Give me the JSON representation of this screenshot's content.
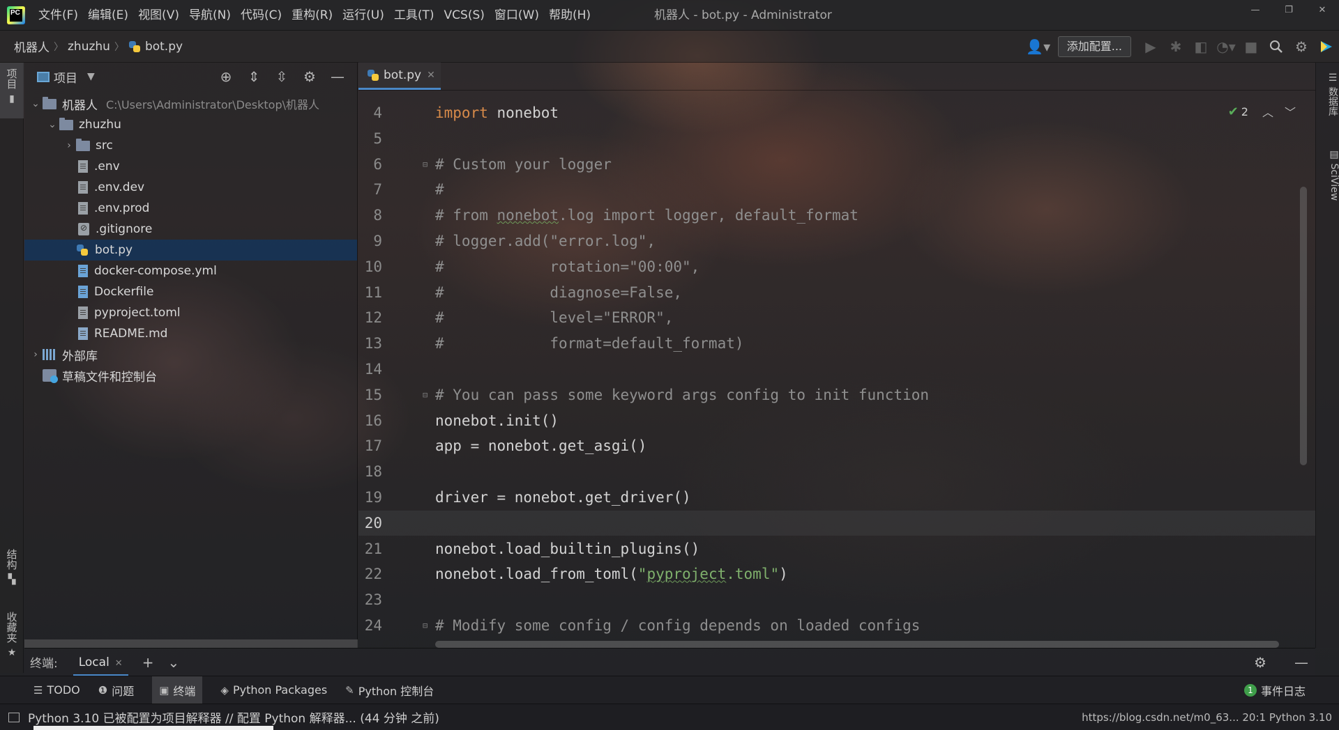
{
  "titlebar": {
    "menu": [
      "文件(F)",
      "编辑(E)",
      "视图(V)",
      "导航(N)",
      "代码(C)",
      "重构(R)",
      "运行(U)",
      "工具(T)",
      "VCS(S)",
      "窗口(W)",
      "帮助(H)"
    ],
    "window_title": "机器人 - bot.py - Administrator",
    "controls": [
      "—",
      "❐",
      "✕"
    ]
  },
  "navbar": {
    "breadcrumb": [
      "机器人",
      "zhuzhu",
      "bot.py"
    ],
    "add_config": "添加配置..."
  },
  "left_strip": {
    "project_tab": "项目",
    "structure_tab": "结构",
    "favorites_tab": "收藏夹"
  },
  "project_panel": {
    "title": "项目",
    "tree": [
      {
        "label": "机器人",
        "hint": "C:\\Users\\Administrator\\Desktop\\机器人",
        "kind": "folder",
        "depth": 0,
        "expanded": true
      },
      {
        "label": "zhuzhu",
        "kind": "folder",
        "depth": 1,
        "expanded": true
      },
      {
        "label": "src",
        "kind": "folder",
        "depth": 2,
        "expanded": false
      },
      {
        "label": ".env",
        "kind": "file",
        "depth": 2
      },
      {
        "label": ".env.dev",
        "kind": "file",
        "depth": 2
      },
      {
        "label": ".env.prod",
        "kind": "file",
        "depth": 2
      },
      {
        "label": ".gitignore",
        "kind": "gitignore",
        "depth": 2
      },
      {
        "label": "bot.py",
        "kind": "python",
        "depth": 2,
        "selected": true
      },
      {
        "label": "docker-compose.yml",
        "kind": "docker",
        "depth": 2
      },
      {
        "label": "Dockerfile",
        "kind": "docker",
        "depth": 2
      },
      {
        "label": "pyproject.toml",
        "kind": "file",
        "depth": 2
      },
      {
        "label": "README.md",
        "kind": "markdown",
        "depth": 2
      },
      {
        "label": "外部库",
        "kind": "library",
        "depth": 0,
        "expanded": false
      },
      {
        "label": "草稿文件和控制台",
        "kind": "scratch",
        "depth": 0
      }
    ]
  },
  "editor": {
    "tab": "bot.py",
    "inspection_count": "2",
    "current_line": 20,
    "lines": [
      {
        "n": "4",
        "html": "<span class=\"kw\">import</span> nonebot"
      },
      {
        "n": "5",
        "html": ""
      },
      {
        "n": "6",
        "html": "<span class=\"cm\"># Custom your logger</span>",
        "fold": true
      },
      {
        "n": "7",
        "html": "<span class=\"cm\">#</span>"
      },
      {
        "n": "8",
        "html": "<span class=\"cm\"># from <span class=\"squig\">nonebot</span>.log import logger, default_format</span>"
      },
      {
        "n": "9",
        "html": "<span class=\"cm\"># logger.add(\"error.log\",</span>"
      },
      {
        "n": "10",
        "html": "<span class=\"cm\">#            rotation=\"00:00\",</span>"
      },
      {
        "n": "11",
        "html": "<span class=\"cm\">#            diagnose=False,</span>"
      },
      {
        "n": "12",
        "html": "<span class=\"cm\">#            level=\"ERROR\",</span>"
      },
      {
        "n": "13",
        "html": "<span class=\"cm\">#            format=default_format)</span>"
      },
      {
        "n": "14",
        "html": ""
      },
      {
        "n": "15",
        "html": "<span class=\"cm\"># You can pass some keyword args config to init function</span>",
        "fold": true
      },
      {
        "n": "16",
        "html": "nonebot.init()"
      },
      {
        "n": "17",
        "html": "app = nonebot.get_asgi()"
      },
      {
        "n": "18",
        "html": ""
      },
      {
        "n": "19",
        "html": "driver = nonebot.get_driver()"
      },
      {
        "n": "20",
        "html": ""
      },
      {
        "n": "21",
        "html": "nonebot.load_builtin_plugins()"
      },
      {
        "n": "22",
        "html": "nonebot.load_from_toml(<span class=\"str\">\"<span class=\"squig\">pyproject</span>.toml\"</span>)"
      },
      {
        "n": "23",
        "html": ""
      },
      {
        "n": "24",
        "html": "<span class=\"cm\"># Modify some config / config depends on loaded configs</span>",
        "fold": true
      }
    ]
  },
  "right_strip": {
    "database_tab": "数据库",
    "sciview_tab": "SciView"
  },
  "terminal": {
    "label": "终端:",
    "tab": "Local"
  },
  "bottom_tabs": [
    {
      "icon": "list-icon",
      "glyph": "☰",
      "label": "TODO"
    },
    {
      "icon": "problems-icon",
      "glyph": "❶",
      "label": "问题"
    },
    {
      "icon": "terminal-icon",
      "glyph": "▣",
      "label": "终端",
      "active": true
    },
    {
      "icon": "packages-icon",
      "glyph": "◈",
      "label": "Python Packages"
    },
    {
      "icon": "python-console-icon",
      "glyph": "✎",
      "label": "Python 控制台"
    }
  ],
  "event_log": {
    "count": "1",
    "label": "事件日志"
  },
  "statusbar": {
    "message": "Python 3.10 已被配置为项目解释器 // 配置 Python 解释器... (44 分钟 之前)",
    "right": "https://blog.csdn.net/m0_63...  20:1  Python 3.10"
  }
}
